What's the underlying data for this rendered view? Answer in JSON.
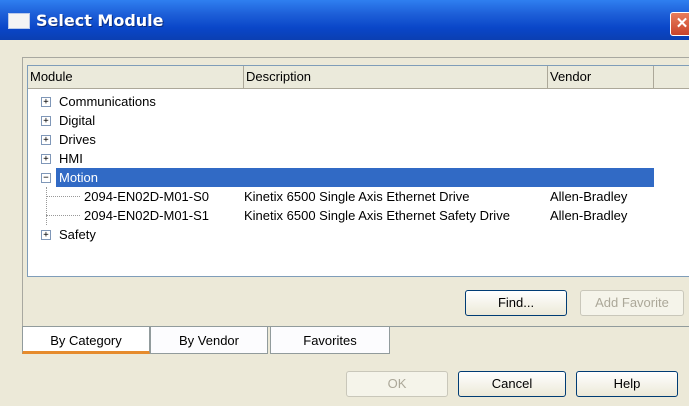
{
  "window": {
    "title": "Select Module",
    "close_glyph": "✕"
  },
  "columns": {
    "module": "Module",
    "description": "Description",
    "vendor": "Vendor"
  },
  "tree": [
    {
      "label": "Communications",
      "expander": "+"
    },
    {
      "label": "Digital",
      "expander": "+"
    },
    {
      "label": "Drives",
      "expander": "+"
    },
    {
      "label": "HMI",
      "expander": "+"
    },
    {
      "label": "Motion",
      "expander": "−",
      "selected": true,
      "children": [
        {
          "module": "2094-EN02D-M01-S0",
          "description": "Kinetix 6500 Single Axis Ethernet Drive",
          "vendor": "Allen-Bradley"
        },
        {
          "module": "2094-EN02D-M01-S1",
          "description": "Kinetix 6500 Single Axis Ethernet Safety Drive",
          "vendor": "Allen-Bradley"
        }
      ]
    },
    {
      "label": "Safety",
      "expander": "+"
    }
  ],
  "buttons": {
    "find": "Find...",
    "add_favorite": "Add Favorite",
    "ok": "OK",
    "cancel": "Cancel",
    "help": "Help"
  },
  "tabs": [
    "By Category",
    "By Vendor",
    "Favorites"
  ],
  "colors": {
    "title_bar": "#0a46c8",
    "selection": "#316ac5",
    "active_tab_accent": "#e68b2c"
  }
}
